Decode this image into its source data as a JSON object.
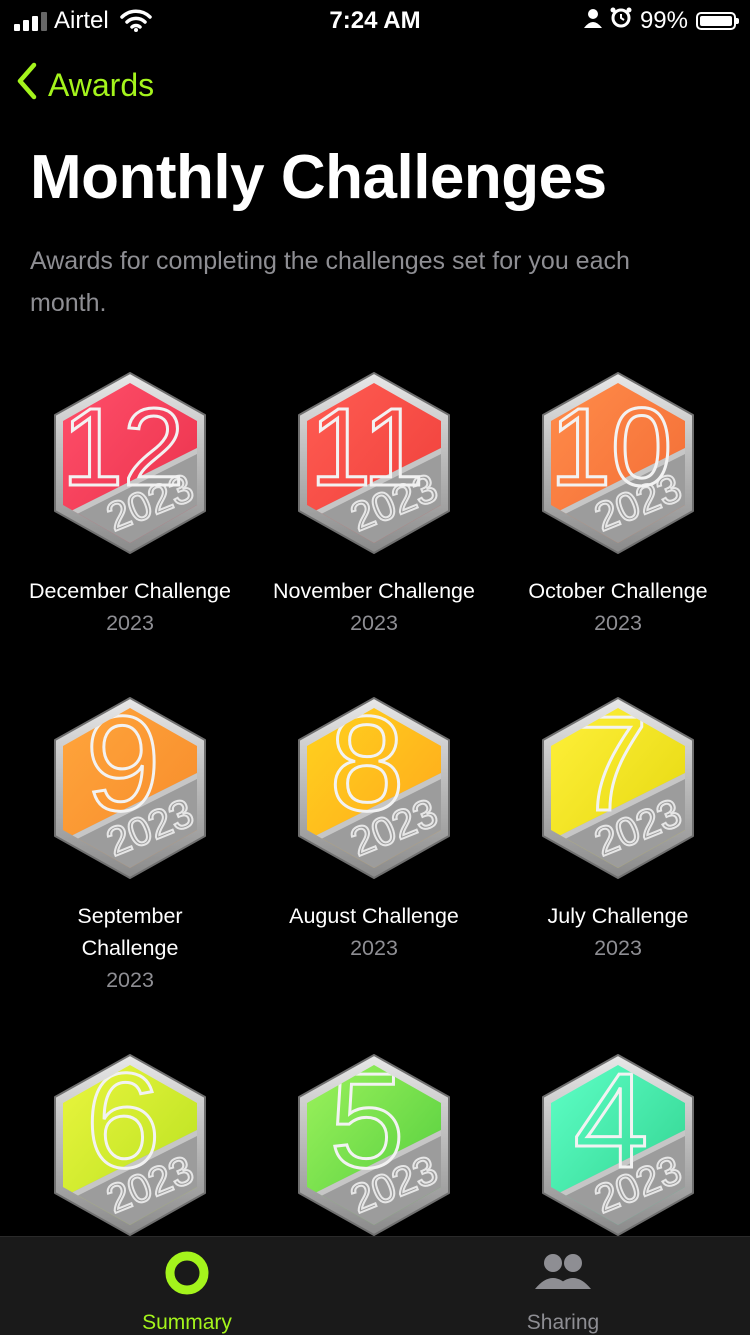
{
  "status_bar": {
    "carrier": "Airtel",
    "time": "7:24 AM",
    "battery": "99%",
    "icons": [
      "signal-icon",
      "wifi-icon",
      "person-icon",
      "alarm-icon",
      "battery-icon"
    ]
  },
  "nav": {
    "back_label": "Awards"
  },
  "page": {
    "title": "Monthly Challenges",
    "description": "Awards for completing the challenges set for you each month."
  },
  "awards": [
    {
      "name": "December Challenge",
      "year": "2023",
      "digit": "12",
      "color_top": "#ff4f6a",
      "color_bottom": "#e9304a"
    },
    {
      "name": "November Challenge",
      "year": "2023",
      "digit": "11",
      "color_top": "#ff5c52",
      "color_bottom": "#ee3e3a"
    },
    {
      "name": "October Challenge",
      "year": "2023",
      "digit": "10",
      "color_top": "#ff8c4a",
      "color_bottom": "#f26a34"
    },
    {
      "name": "September Challenge",
      "year": "2023",
      "digit": "9",
      "color_top": "#ffa53c",
      "color_bottom": "#f68a2a"
    },
    {
      "name": "August Challenge",
      "year": "2023",
      "digit": "8",
      "color_top": "#ffd21e",
      "color_bottom": "#ffa51c"
    },
    {
      "name": "July Challenge",
      "year": "2023",
      "digit": "7",
      "color_top": "#fff03a",
      "color_bottom": "#e3d60c"
    },
    {
      "name": "",
      "year": "",
      "digit": "6",
      "color_top": "#eaf53e",
      "color_bottom": "#b5e01e"
    },
    {
      "name": "",
      "year": "",
      "digit": "5",
      "color_top": "#9cf25c",
      "color_bottom": "#4ecb3c"
    },
    {
      "name": "",
      "year": "",
      "digit": "4",
      "color_top": "#5effc6",
      "color_bottom": "#2ed08c"
    }
  ],
  "tabbar": {
    "summary_label": "Summary",
    "sharing_label": "Sharing",
    "active_color": "#a4f41c",
    "inactive_color": "#8e8e93"
  }
}
